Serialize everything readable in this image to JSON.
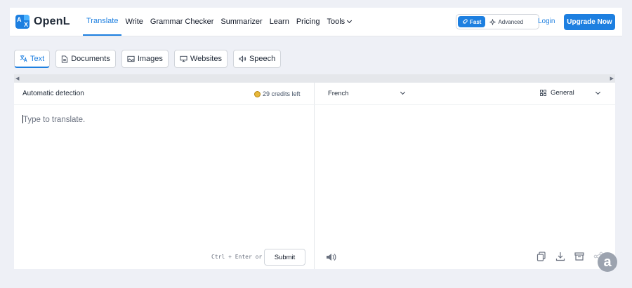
{
  "brand": {
    "name": "OpenL",
    "logo_letters": [
      "A",
      "X"
    ]
  },
  "nav": {
    "items": [
      "Translate",
      "Write",
      "Grammar Checker",
      "Summarizer",
      "Learn",
      "Pricing",
      "Tools"
    ],
    "active": "Translate"
  },
  "mode": {
    "fast": "Fast",
    "advanced": "Advanced"
  },
  "header_actions": {
    "login": "Login",
    "upgrade": "Upgrade Now"
  },
  "tabs": [
    {
      "label": "Text",
      "icon": "translate-icon"
    },
    {
      "label": "Documents",
      "icon": "document-icon"
    },
    {
      "label": "Images",
      "icon": "image-icon"
    },
    {
      "label": "Websites",
      "icon": "monitor-icon"
    },
    {
      "label": "Speech",
      "icon": "speaker-icon"
    }
  ],
  "source": {
    "language": "Automatic detection",
    "credits": "29 credits left",
    "placeholder": "Type to translate.",
    "shortcut": "Ctrl + Enter or",
    "submit": "Submit"
  },
  "target": {
    "language": "French",
    "style": "General"
  },
  "colors": {
    "accent": "#1d7fe0",
    "background": "#eef0f6"
  }
}
